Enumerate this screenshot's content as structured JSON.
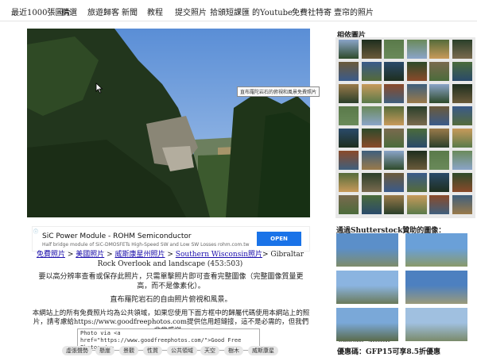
{
  "nav": {
    "items": [
      "最近1000張圖片",
      "精選",
      "旅遊歸客",
      "新聞",
      "教程",
      "提交照片",
      "拾頒短課匯",
      "的Youtube",
      "免費社特寄",
      "壹帘的照片"
    ],
    "colors": {
      "text": "#222222",
      "bg": "#ffffff"
    }
  },
  "photo": {
    "tooltip": "直布羅陀岩石的俯視和風景免費照片",
    "cursor_icon": "cursor-arrow-icon"
  },
  "ad": {
    "title": "SiC Power Module - ROHM Semiconductor",
    "subtitle": "Half bridge module of SiC-DMOSFETs High-Speed SW and Low SW Losses rohm.com.tw",
    "button": "OPEN",
    "info_icon": "ad-info-icon"
  },
  "breadcrumb": {
    "links": [
      "免費照片",
      "美國照片",
      "威斯康星州照片",
      "Southern Wisconsin照片"
    ],
    "separator": " > ",
    "tail": "> Gibraltar Rock Overlook and landscape (453:503)"
  },
  "content": {
    "download_hint": "要以高分辨率查看或保存此照片，只需單擊照片即可查看完整圖像（完整圖像質量更高，而不是像素化）。",
    "caption": "直布羅陀岩石的自由照片俯視和風景。",
    "license_text": "本網站上的所有免費照片均為公共領域，如果您使用下面方框中的歸屬代碼使用本網站上的照片，請考慮給https://www.goodfreephotos.com提供信用超鏈接，這不是必需的，但我們非常感謝。",
    "code_box": "Photo via <a href=\"https://www.goodfreephotos.com/\">Good Free Photos</a>"
  },
  "tags": [
    "虛張聲勢",
    "懸崖",
    "景觀",
    "性質",
    "公共領域",
    "天空",
    "樹木",
    "威斯康星"
  ],
  "sidebar": {
    "related_title": "相依圖片",
    "shutterstock_title": "通過Shutterstock贊助的圖像：",
    "shutterstock_label": "shutterstock · 419069916",
    "promo": "優惠碼：GFP15可享8.5折優惠"
  }
}
